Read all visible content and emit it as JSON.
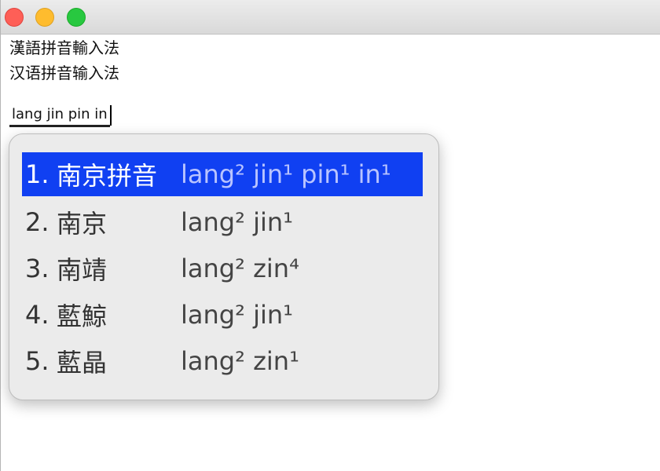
{
  "text_lines": [
    "漢語拼音輸入法",
    "汉语拼音输入法"
  ],
  "composition": "lang jin pin in",
  "candidates": [
    {
      "index": "1.",
      "word": "南京拼音",
      "reading": "lang² jin¹ pin¹ in¹",
      "selected": true
    },
    {
      "index": "2.",
      "word": "南京",
      "reading": "lang² jin¹"
    },
    {
      "index": "3.",
      "word": "南靖",
      "reading": "lang² zin⁴"
    },
    {
      "index": "4.",
      "word": "藍鯨",
      "reading": "lang² jin¹"
    },
    {
      "index": "5.",
      "word": "藍晶",
      "reading": "lang² zin¹"
    }
  ],
  "colors": {
    "selection": "#1040f2",
    "close": "#fe5f57",
    "minimize": "#febc2e",
    "zoom": "#28c840"
  }
}
